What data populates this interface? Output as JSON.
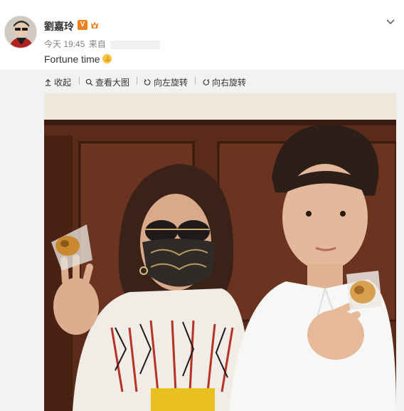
{
  "post": {
    "username": "劉嘉玲",
    "v_badge": "V",
    "time": "今天 19:45",
    "source_prefix": "来自",
    "text": "Fortune time"
  },
  "toolbar": {
    "collapse": "收起",
    "view_large": "查看大图",
    "rotate_left": "向左旋转",
    "rotate_right": "向右旋转"
  },
  "icons": {
    "verified": "verified-v-badge",
    "member": "vip-member-icon",
    "emoji": "thumbs-up-emoji",
    "chevron": "chevron-down-icon"
  },
  "colors": {
    "badge_orange": "#f2801f",
    "toolbar_bg": "#f2f2f5",
    "text_gray": "#808080"
  }
}
